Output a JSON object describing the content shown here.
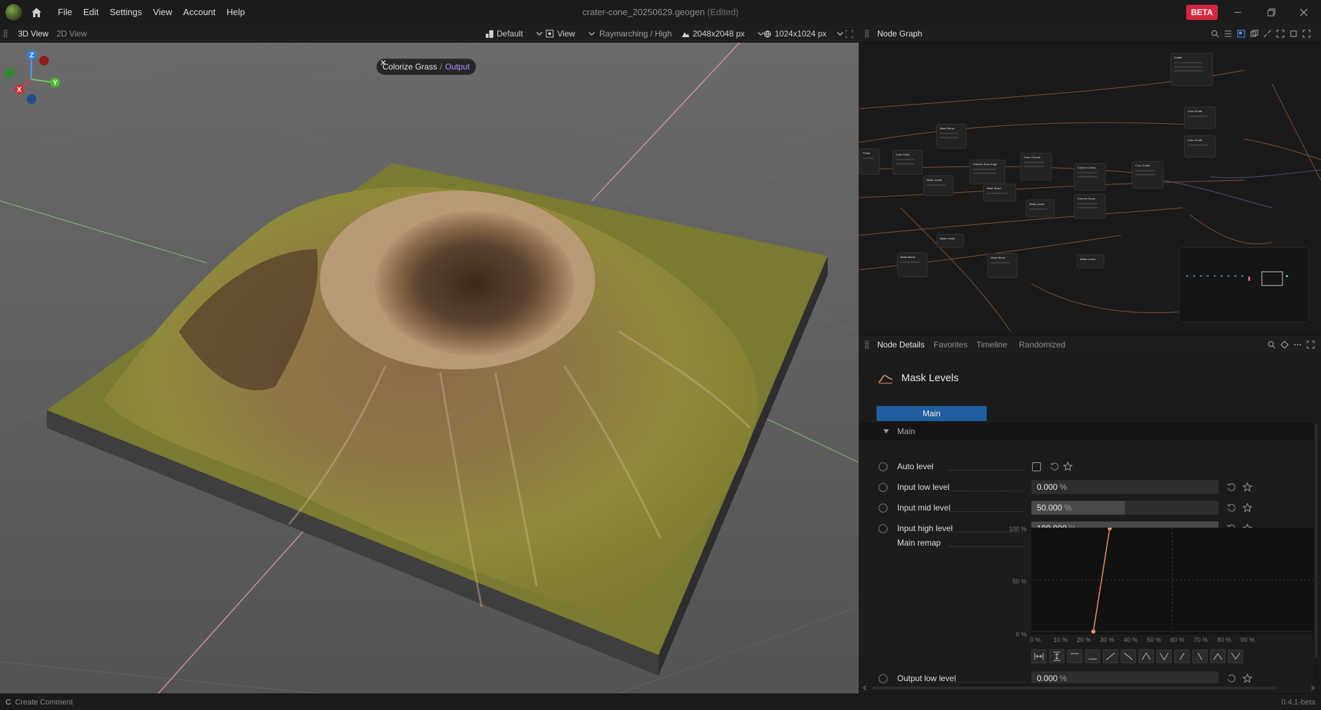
{
  "app": {
    "menu": [
      "File",
      "Edit",
      "Settings",
      "View",
      "Account",
      "Help"
    ],
    "document_title": "crater-cone_20250629.geogen",
    "edited_suffix": "(Edited)",
    "beta_label": "BETA"
  },
  "viewport_bar": {
    "tabs": [
      "3D View",
      "2D View"
    ],
    "preset": "Default",
    "view": "View",
    "render_mode": "Raymarching / High",
    "resolution": "2048x2048 px",
    "preview_resolution": "1024x1024 px"
  },
  "viewport": {
    "breadcrumb_node": "Colorize Grass",
    "breadcrumb_sep": "/",
    "breadcrumb_output": "Output",
    "gizmo": {
      "z": "Z",
      "y": "Y",
      "x": "X"
    }
  },
  "node_graph": {
    "title": "Node Graph",
    "nodes": [
      "Mask Blend",
      "Color Fade",
      "Colorize Rock Edge",
      "Color Ground",
      "Colorize Grass",
      "Color Erode",
      "Mask Cavity",
      "Mask Levels",
      "Colorize Snow",
      "Scatter",
      "Mask Slope",
      "Portal"
    ]
  },
  "details_tabs": [
    "Node Details",
    "Favorites",
    "Timeline",
    "Randomized"
  ],
  "node_details": {
    "node_name": "Mask Levels",
    "page_tab": "Main",
    "section": "Main",
    "auto_level_label": "Auto level",
    "params": [
      {
        "label": "Input low level",
        "value": "0.000",
        "unit": "%",
        "fraction": 0.0
      },
      {
        "label": "Input mid level",
        "value": "50.000",
        "unit": "%",
        "fraction": 0.5
      },
      {
        "label": "Input high level",
        "value": "100.000",
        "unit": "%",
        "fraction": 1.0
      }
    ],
    "remap_label": "Main remap",
    "curve": {
      "y_ticks": [
        "100 %",
        "50 %",
        "0 %"
      ],
      "x_ticks": [
        "0 %",
        "10 %",
        "20 %",
        "30 %",
        "40 %",
        "50 %",
        "60 %",
        "70 %",
        "80 %",
        "90 %"
      ],
      "points": [
        {
          "x": 26.5,
          "y": 0
        },
        {
          "x": 33.5,
          "y": 100
        }
      ]
    },
    "output_low_label": "Output low level",
    "output_low_value": "0.000",
    "output_low_unit": "%"
  },
  "statusbar": {
    "key": "C",
    "hint": "Create Comment",
    "version": "0.4.1-beta"
  },
  "colors": {
    "accent_blue": "#1f5f9f",
    "beta_red": "#d7263d",
    "output_purple": "#b48cff",
    "curve_orange": "#f0906a"
  }
}
